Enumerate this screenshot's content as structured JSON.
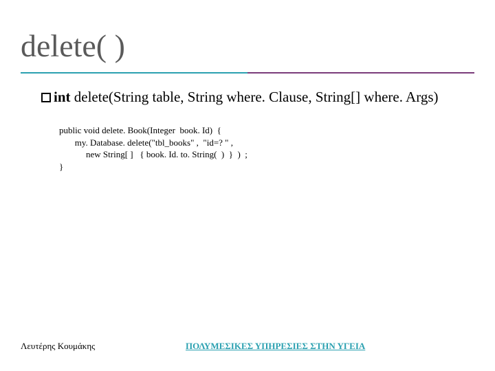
{
  "title": "delete( )",
  "signature": {
    "part1": "int",
    "part2": "  delete(String table, String where. Clause, String[] where. Args)"
  },
  "code": {
    "line1": "public void delete. Book(Integer  book. Id)  {",
    "line2": "       my. Database. delete(\"tbl_books\" ,  \"id=? \" ,",
    "line3": "            new String[ ]   { book. Id. to. String(  )  }  )  ;",
    "line4": "}"
  },
  "footer": {
    "left": "Λευτέρης Κουμάκης",
    "center": "ΠΟΛΥΜΕΣΙΚΕΣ ΥΠΗΡΕΣΙΕΣ ΣΤΗΝ ΥΓΕΙΑ"
  }
}
